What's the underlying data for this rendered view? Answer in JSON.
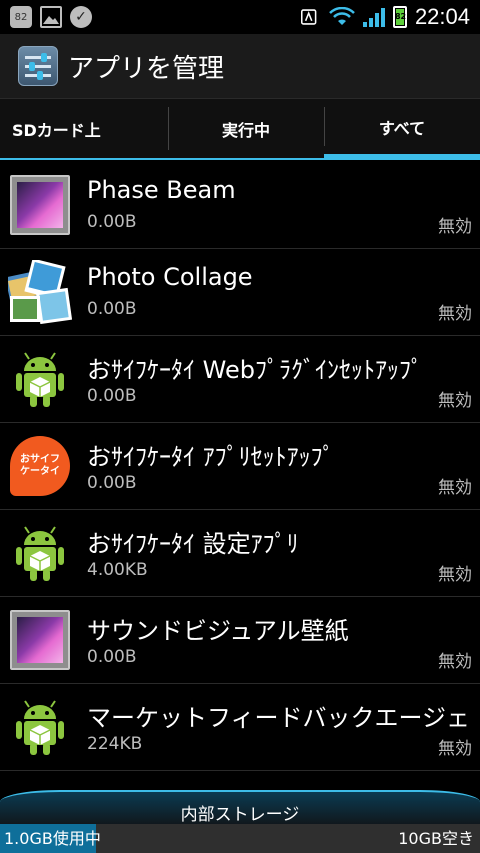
{
  "status_bar": {
    "notification_badge": "82",
    "battery_level": "82",
    "time": "22:04"
  },
  "action_bar": {
    "title": "アプリを管理"
  },
  "tabs": [
    {
      "label": "SDカード上",
      "active": false
    },
    {
      "label": "実行中",
      "active": false
    },
    {
      "label": "すべて",
      "active": true
    }
  ],
  "apps": [
    {
      "name": "Phase Beam",
      "size": "0.00B",
      "state": "無効",
      "icon": "wallpaper-frame-icon"
    },
    {
      "name": "Photo Collage",
      "size": "0.00B",
      "state": "無効",
      "icon": "photo-collage-icon"
    },
    {
      "name": "おｻｲﾌｹｰﾀｲ Webﾌﾟﾗｸﾞｲﾝｾｯﾄｱｯﾌﾟ",
      "size": "0.00B",
      "state": "無効",
      "icon": "android-robot-icon"
    },
    {
      "name": "おｻｲﾌｹｰﾀｲ ｱﾌﾟﾘｾｯﾄｱｯﾌﾟ",
      "size": "0.00B",
      "state": "無効",
      "icon": "osaifu-keitai-icon"
    },
    {
      "name": "おｻｲﾌｹｰﾀｲ 設定ｱﾌﾟﾘ",
      "size": "4.00KB",
      "state": "無効",
      "icon": "android-robot-icon"
    },
    {
      "name": "サウンドビジュアル壁紙",
      "size": "0.00B",
      "state": "無効",
      "icon": "wallpaper-frame-icon"
    },
    {
      "name": "マーケットフィードバックエージェ",
      "size": "224KB",
      "state": "無効",
      "icon": "android-robot-icon"
    }
  ],
  "osaifu_icon_text": [
    "おサイフ",
    "ケータイ"
  ],
  "storage": {
    "label": "内部ストレージ",
    "used": "1.0GB使用中",
    "free": "10GB空き",
    "used_fraction": 0.2
  },
  "colors": {
    "accent": "#3dbde9",
    "android_green": "#8cc63f"
  }
}
